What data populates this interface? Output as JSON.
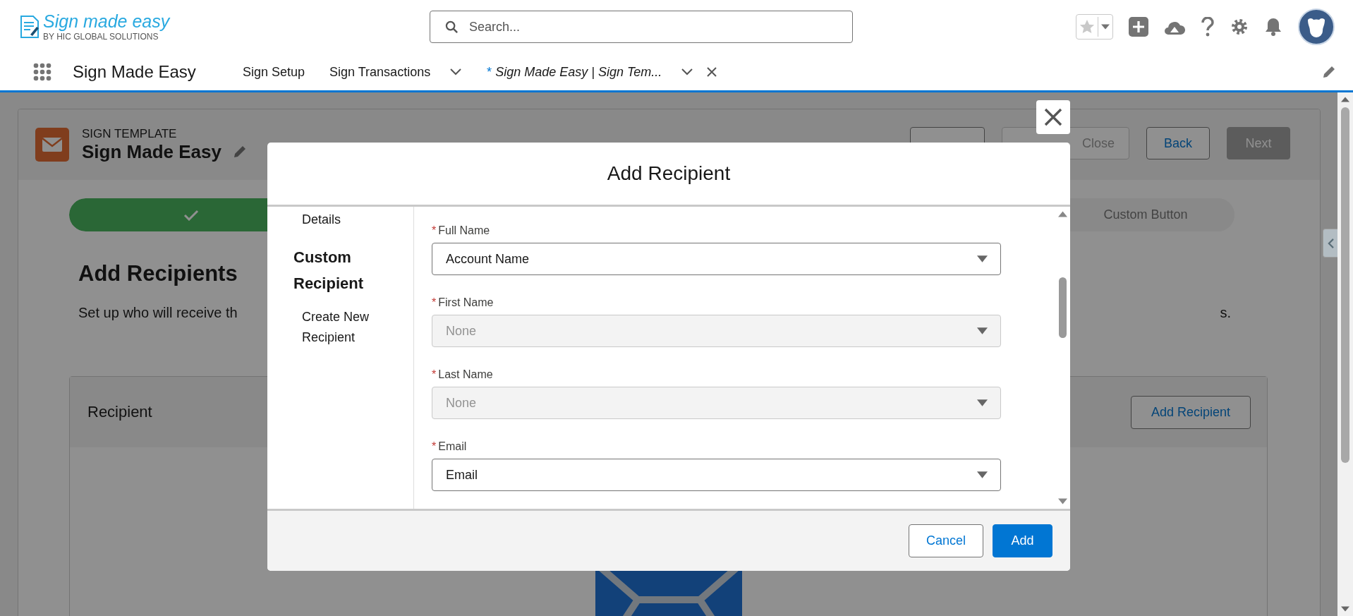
{
  "header": {
    "logo": {
      "title": "Sign made easy",
      "subtitle": "BY HIC GLOBAL SOLUTIONS"
    },
    "search": {
      "placeholder": "Search..."
    }
  },
  "nav": {
    "app_name": "Sign Made Easy",
    "tabs": [
      {
        "label": "Sign Setup",
        "selected": false,
        "kind": "plain"
      },
      {
        "label": "Sign Transactions",
        "selected": false,
        "kind": "menu"
      },
      {
        "prefix": "*",
        "label": "Sign Made Easy | Sign Tem...",
        "selected": true,
        "kind": "closable"
      }
    ]
  },
  "record": {
    "type_label": "SIGN TEMPLATE",
    "title": "Sign Made Easy",
    "buttons": [
      {
        "kind": "neutral",
        "disabled": false
      },
      {
        "label": "Close",
        "kind": "neutral",
        "disabled": true
      },
      {
        "label": "Back",
        "kind": "neutral",
        "disabled": false
      },
      {
        "label": "Next",
        "kind": "brand",
        "disabled": true
      }
    ]
  },
  "path": [
    {
      "complete": true
    },
    {
      "label": "Custom Button",
      "complete": false
    }
  ],
  "section": {
    "title": "Add Recipients",
    "description_start": "Set up who will receive th",
    "description_end": "s."
  },
  "recipient_card": {
    "title": "Recipient",
    "button": "Add Recipient"
  },
  "modal": {
    "title": "Add Recipient",
    "nav": [
      {
        "label": "Details",
        "kind": "item"
      },
      {
        "label": "Custom Recipient",
        "kind": "heading"
      },
      {
        "label": "Create New Recipient",
        "kind": "item"
      }
    ],
    "fields": [
      {
        "required_mark": "*",
        "label": "Full Name",
        "value": "Account Name",
        "disabled": false
      },
      {
        "required_mark": "*",
        "label": "First Name",
        "value": "None",
        "disabled": true
      },
      {
        "required_mark": "*",
        "label": "Last Name",
        "value": "None",
        "disabled": true
      },
      {
        "required_mark": "*",
        "label": "Email",
        "value": "Email",
        "disabled": false
      }
    ],
    "buttons": [
      {
        "label": "Cancel",
        "kind": "neutral"
      },
      {
        "label": "Add",
        "kind": "brand"
      }
    ]
  }
}
